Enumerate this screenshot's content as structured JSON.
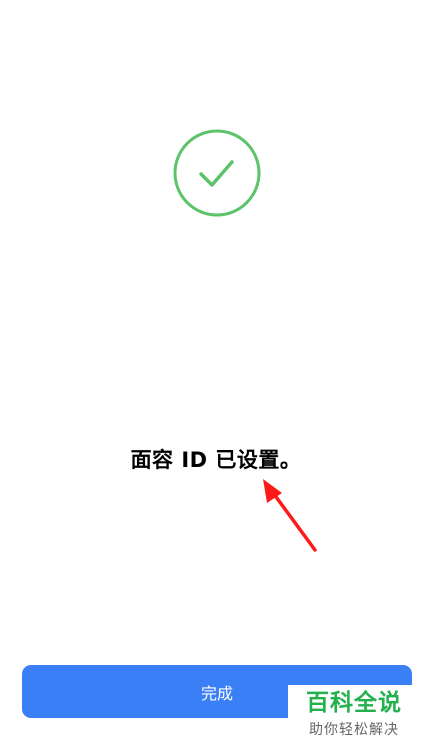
{
  "status": {
    "icon": "checkmark-circle-icon",
    "color": "#5cc36a"
  },
  "message": "面容 ID 已设置。",
  "annotation": {
    "icon": "red-arrow-icon",
    "color": "#ff1a1a"
  },
  "done_button": {
    "label": "完成",
    "color": "#3a7ff6"
  },
  "watermark": {
    "main": "百科全说",
    "sub": "助你轻松解决"
  }
}
